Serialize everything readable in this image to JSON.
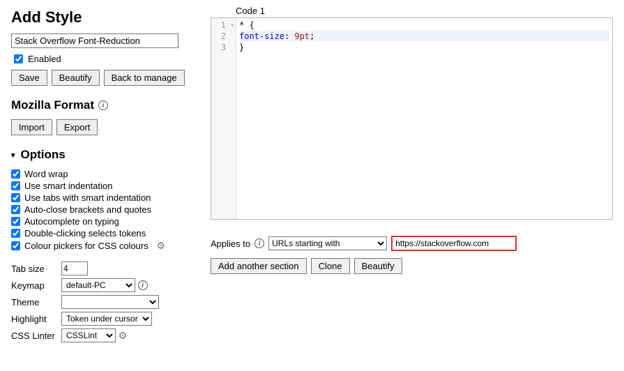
{
  "header": {
    "title": "Add Style"
  },
  "style_name": "Stack Overflow Font-Reduction",
  "enabled": {
    "label": "Enabled",
    "checked": true
  },
  "buttons": {
    "save": "Save",
    "beautify": "Beautify",
    "back": "Back to manage",
    "import": "Import",
    "export": "Export"
  },
  "mozilla": {
    "heading": "Mozilla Format"
  },
  "options": {
    "heading": "Options",
    "items": [
      {
        "label": "Word wrap",
        "checked": true
      },
      {
        "label": "Use smart indentation",
        "checked": true
      },
      {
        "label": "Use tabs with smart indentation",
        "checked": true
      },
      {
        "label": "Auto-close brackets and quotes",
        "checked": true
      },
      {
        "label": "Autocomplete on typing",
        "checked": true
      },
      {
        "label": "Double-clicking selects tokens",
        "checked": true
      },
      {
        "label": "Colour pickers for CSS colours",
        "checked": true,
        "gear": true
      }
    ],
    "tabsize": {
      "label": "Tab size",
      "value": "4"
    },
    "keymap": {
      "label": "Keymap",
      "value": "default-PC",
      "info": true
    },
    "theme": {
      "label": "Theme",
      "value": ""
    },
    "highlight": {
      "label": "Highlight",
      "value": "Token under cursor"
    },
    "linter": {
      "label": "CSS Linter",
      "value": "CSSLint",
      "gear": true
    }
  },
  "editor": {
    "label": "Code 1",
    "lines": [
      "1",
      "2",
      "3"
    ],
    "code_l1": "* {",
    "code_l2_indent": "    ",
    "code_l2_prop": "font-size",
    "code_l2_sep": ": ",
    "code_l2_val": "9pt",
    "code_l2_end": ";",
    "code_l3": "}"
  },
  "applies": {
    "label": "Applies to",
    "select": "URLs starting with",
    "url": "https://stackoverflow.com"
  },
  "section_buttons": {
    "add": "Add another section",
    "clone": "Clone",
    "beautify": "Beautify"
  },
  "chart_data": {
    "type": "table",
    "title": "CSS snippet",
    "rows": [
      {
        "line": 1,
        "text": "* {"
      },
      {
        "line": 2,
        "text": "    font-size: 9pt;"
      },
      {
        "line": 3,
        "text": "}"
      }
    ]
  }
}
